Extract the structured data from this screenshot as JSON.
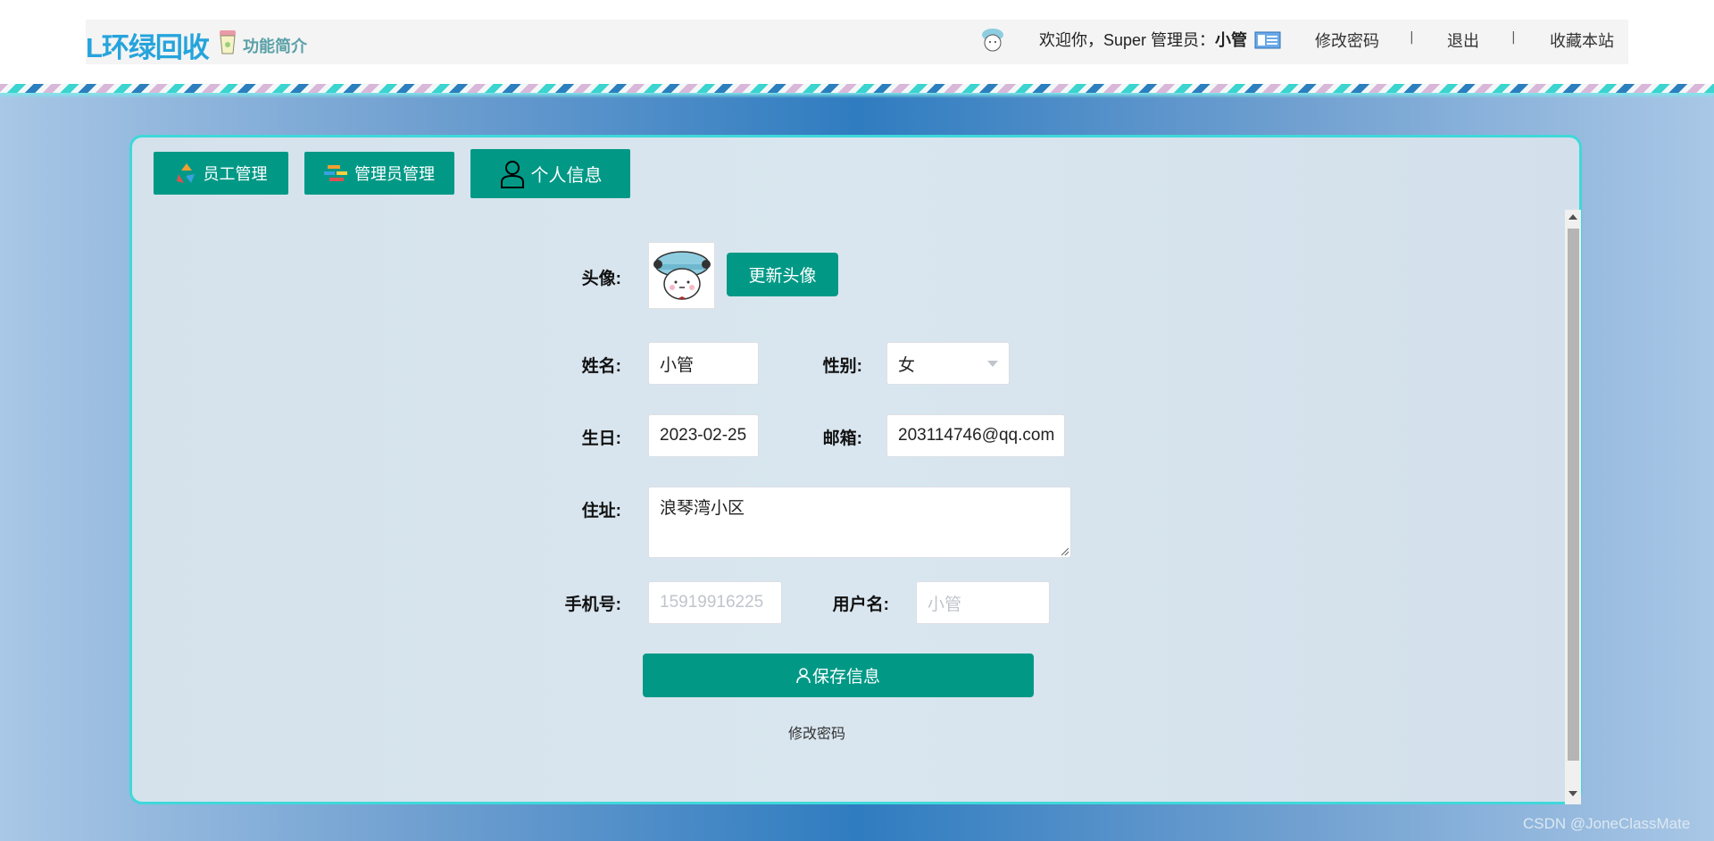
{
  "header": {
    "brand": "L环绿回收",
    "brand_sub": "功能简介",
    "welcome_prefix": "欢迎你，Super 管理员：",
    "welcome_name": "小管",
    "change_password": "修改密码",
    "separator": "|",
    "logout": "退出",
    "bookmark": "收藏本站"
  },
  "tabs": [
    {
      "label": "员工管理",
      "icon": "recycle-icon"
    },
    {
      "label": "管理员管理",
      "icon": "admin-icon"
    },
    {
      "label": "个人信息",
      "icon": "user-icon"
    }
  ],
  "form": {
    "avatar_label": "头像:",
    "update_avatar": "更新头像",
    "name_label": "姓名:",
    "name_value": "小管",
    "gender_label": "性别:",
    "gender_value": "女",
    "birthday_label": "生日:",
    "birthday_value": "2023-02-25",
    "email_label": "邮箱:",
    "email_value": "203114746@qq.com",
    "address_label": "住址:",
    "address_value": "浪琴湾小区",
    "phone_label": "手机号:",
    "phone_placeholder": "15919916225",
    "username_label": "用户名:",
    "username_placeholder": "小管",
    "save_button": "保存信息",
    "change_password_link": "修改密码"
  },
  "watermark": "CSDN @JoneClassMate",
  "colors": {
    "accent": "#019986",
    "brand": "#25a4dc",
    "panel_border": "#3fd8da"
  }
}
